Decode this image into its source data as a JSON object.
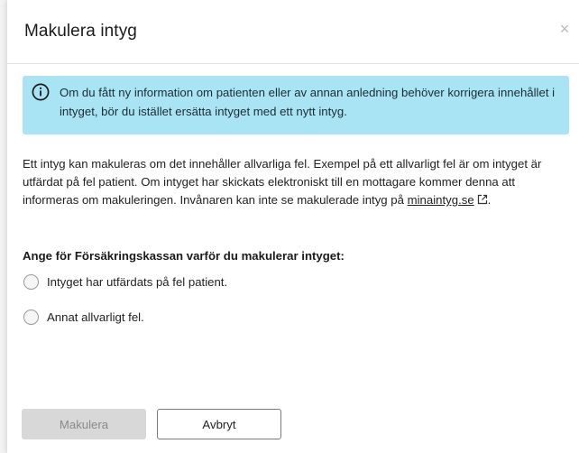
{
  "dialog": {
    "title": "Makulera intyg",
    "close_icon": "×"
  },
  "info_box": {
    "icon": "info-circle-icon",
    "text": "Om du fått ny information om patienten eller av annan anledning behöver korrigera innehållet i intyget, bör du istället ersätta intyget med ett nytt intyg.",
    "background": "#a9e4f4"
  },
  "body": {
    "text": "Ett intyg kan makuleras om det innehåller allvarliga fel. Exempel på ett allvarligt fel är om intyget är utfärdat på fel patient. Om intyget har skickats elektroniskt till en mottagare kommer denna att informeras om makuleringen. Invånaren kan inte se makulerade intyg på ",
    "link_text": "minaintyg.se",
    "link_icon": "external-link-icon",
    "after_link": "."
  },
  "question": {
    "label": "Ange för Försäkringskassan varför du makulerar intyget:",
    "options": [
      {
        "label": "Intyget har utfärdats på fel patient.",
        "selected": false
      },
      {
        "label": "Annat allvarligt fel.",
        "selected": false
      }
    ]
  },
  "footer": {
    "primary_label": "Makulera",
    "primary_disabled": true,
    "secondary_label": "Avbryt"
  }
}
